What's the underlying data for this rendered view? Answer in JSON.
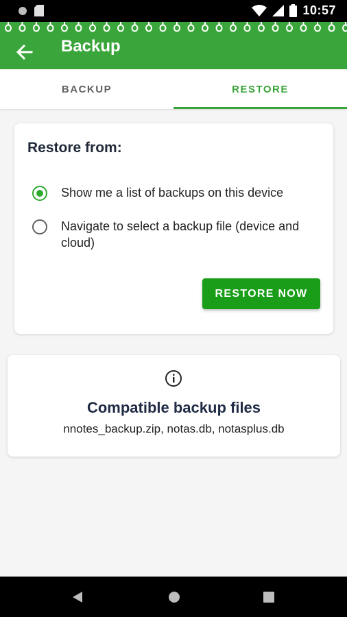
{
  "status_bar": {
    "time": "10:57",
    "icons": [
      "notification-dot-icon",
      "sd-card-icon",
      "wifi-icon",
      "signal-icon",
      "battery-icon"
    ]
  },
  "app_bar": {
    "title": "Backup",
    "back_icon": "arrow-left-icon",
    "color": "#3aa53a"
  },
  "tabs": [
    {
      "label": "BACKUP",
      "selected": false
    },
    {
      "label": "RESTORE",
      "selected": true
    }
  ],
  "restore_card": {
    "heading": "Restore from:",
    "options": [
      {
        "label": "Show me a list of backups on this device",
        "checked": true
      },
      {
        "label": "Navigate to select a backup file (device and cloud)",
        "checked": false
      }
    ],
    "button_label": "RESTORE NOW"
  },
  "info_card": {
    "icon": "info-icon",
    "title": "Compatible backup files",
    "files": "nnotes_backup.zip, notas.db, notasplus.db"
  },
  "nav_bar": {
    "icons": [
      "nav-back-icon",
      "nav-home-icon",
      "nav-recents-icon"
    ]
  },
  "colors": {
    "accent": "#3aa53a",
    "button": "#1a9e1a",
    "background": "#f5f5f5"
  }
}
